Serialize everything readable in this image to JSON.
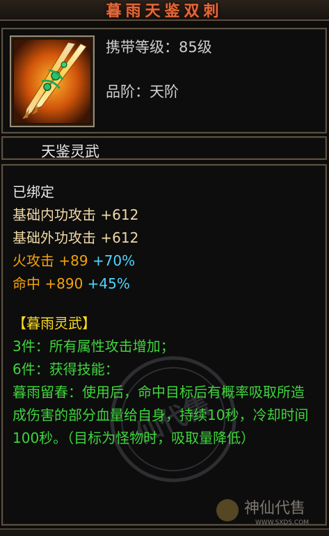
{
  "item": {
    "title": "暮雨天鉴双刺",
    "level_label": "携带等级：85级",
    "grade_label": "品阶：天阶",
    "weapon_name": "天鉴灵武",
    "icon": "twin-daggers-icon"
  },
  "attributes": [
    {
      "text": "已绑定",
      "color": "white"
    },
    {
      "text": "基础内功攻击  +612",
      "color": "wheat"
    },
    {
      "text": "基础外功攻击  +612",
      "color": "wheat"
    }
  ],
  "elemental": [
    {
      "label": "火攻击",
      "value": "+89",
      "bonus": "+70%"
    },
    {
      "label": "命中",
      "value": "+890",
      "bonus": "+45%"
    }
  ],
  "set_bonus": {
    "header": "【暮雨灵武】",
    "lines": [
      "3件：所有属性攻击增加；",
      "6件：获得技能：",
      "暮雨留春：使用后，命中目标后有概率吸取所造成伤害的部分血量给自身，持续10秒，冷却时间100秒。（目标为怪物时，吸取量降低）"
    ]
  },
  "watermark": {
    "stamp_text": "仙代售",
    "logo_text": "神仙代售",
    "logo_url": "WWW.SXDS.COM"
  },
  "colors": {
    "title": "#e2693a",
    "wheat": "#f1d9a6",
    "orange": "#f3a10c",
    "cyan": "#4fd6ff",
    "yellow": "#ffde1c",
    "green": "#3fd53d"
  }
}
